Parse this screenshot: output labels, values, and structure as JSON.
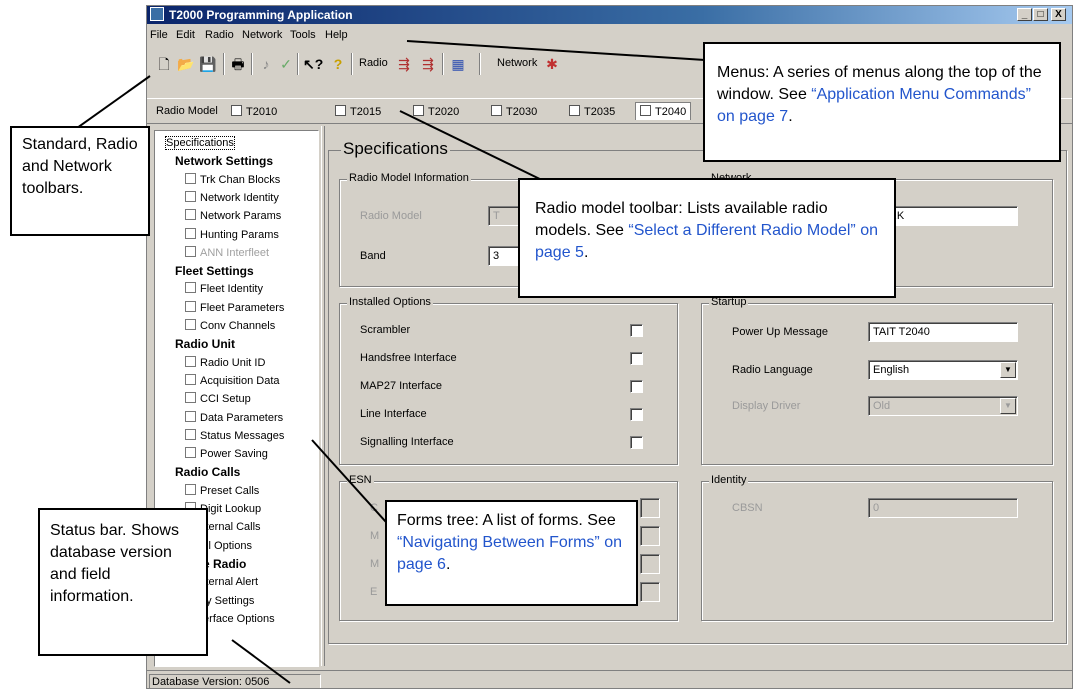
{
  "window": {
    "title": "T2000 Programming Application",
    "buttons": {
      "minimize": "_",
      "maximize": "□",
      "close": "X"
    }
  },
  "menubar": [
    "File",
    "Edit",
    "Radio",
    "Network",
    "Tools",
    "Help"
  ],
  "toolbar": {
    "radio_label": "Radio",
    "network_label": "Network",
    "icons": [
      "new-icon",
      "open-icon",
      "save-icon",
      "print-icon",
      "read-icon",
      "check-icon",
      "help-pointer-icon",
      "help-icon",
      "radio-read-icon",
      "radio-write-icon",
      "radio-program-icon",
      "network-icon"
    ]
  },
  "modelbar": {
    "label": "Radio Model",
    "models": [
      "T2010",
      "T2015",
      "T2020",
      "T2030",
      "T2035",
      "T2040"
    ],
    "active": "T2040"
  },
  "tree": {
    "items": [
      {
        "label": "Specifications",
        "type": "item",
        "selected": true
      },
      {
        "label": "Network Settings",
        "type": "category"
      },
      {
        "label": "Trk Chan Blocks",
        "type": "item"
      },
      {
        "label": "Network Identity",
        "type": "item"
      },
      {
        "label": "Network Params",
        "type": "item"
      },
      {
        "label": "Hunting Params",
        "type": "item"
      },
      {
        "label": "ANN Interfleet",
        "type": "item",
        "disabled": true
      },
      {
        "label": "Fleet Settings",
        "type": "category"
      },
      {
        "label": "Fleet Identity",
        "type": "item"
      },
      {
        "label": "Fleet Parameters",
        "type": "item"
      },
      {
        "label": "Conv Channels",
        "type": "item"
      },
      {
        "label": "Radio Unit",
        "type": "category"
      },
      {
        "label": "Radio Unit ID",
        "type": "item"
      },
      {
        "label": "Acquisition Data",
        "type": "item"
      },
      {
        "label": "CCI Setup",
        "type": "item"
      },
      {
        "label": "Data Parameters",
        "type": "item"
      },
      {
        "label": "Status Messages",
        "type": "item"
      },
      {
        "label": "Power Saving",
        "type": "item"
      },
      {
        "label": "Radio Calls",
        "type": "category"
      },
      {
        "label": "Preset Calls",
        "type": "item"
      },
      {
        "label": "Digit Lookup",
        "type": "item"
      },
      {
        "label": "xternal Calls",
        "type": "item"
      },
      {
        "label": "all Options",
        "type": "item"
      },
      {
        "label": "omise Radio",
        "type": "category"
      },
      {
        "label": "xternal Alert",
        "type": "item"
      },
      {
        "label": "ey Settings",
        "type": "item"
      },
      {
        "label": "terface Options",
        "type": "item"
      }
    ]
  },
  "specifications": {
    "title": "Specifications",
    "radio_model_info": {
      "legend": "Radio Model Information",
      "radio_model_label": "Radio Model",
      "radio_model_value": "T",
      "band_label": "Band",
      "band_value": "3"
    },
    "network": {
      "legend": "Network",
      "value": "VORK"
    },
    "installed_options": {
      "legend": "Installed Options",
      "options": [
        "Scrambler",
        "Handsfree Interface",
        "MAP27 Interface",
        "Line Interface",
        "Signalling Interface"
      ]
    },
    "startup": {
      "legend": "Startup",
      "power_up_label": "Power Up Message",
      "power_up_value": "TAIT T2040",
      "language_label": "Radio Language",
      "language_value": "English",
      "display_label": "Display Driver",
      "display_value": "Old"
    },
    "esn": {
      "legend": "ESN",
      "labels": [
        "C",
        "M",
        "M",
        "E"
      ]
    },
    "identity": {
      "legend": "Identity",
      "cbsn_label": "CBSN",
      "cbsn_value": "0"
    }
  },
  "statusbar": {
    "text": "Database Version: 0506"
  },
  "callouts": {
    "toolbars": "Standard, Radio and Network toolbars.",
    "menus_text": "Menus: A series of menus along the top of the window. See ",
    "menus_ref": "“Application Menu Commands” on page 7",
    "menus_end": ".",
    "modelbar_text": "Radio model toolbar: Lists available radio models. See ",
    "modelbar_ref": "“Select a Different Radio Model” on page 5",
    "modelbar_end": ".",
    "tree_text": "Forms tree: A list of forms. See ",
    "tree_ref": "“Navigating Between Forms” on page 6",
    "tree_end": ".",
    "status": "Status bar. Shows database version and field information."
  }
}
